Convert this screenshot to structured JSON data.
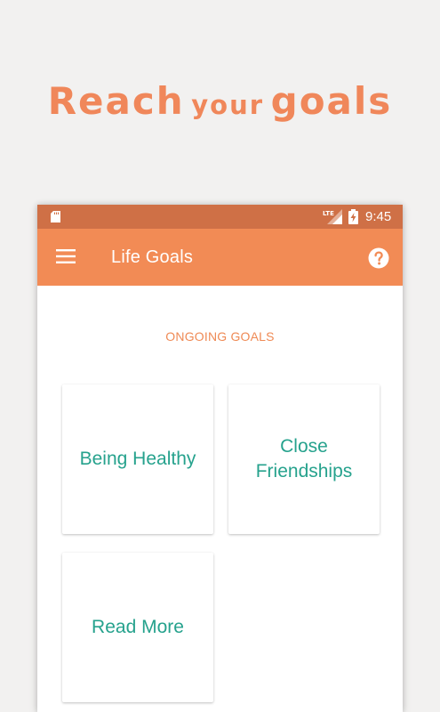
{
  "headline": {
    "word1": "Reach",
    "word2": "your",
    "word3": "goals"
  },
  "status_bar": {
    "network": "LTE",
    "time": "9:45"
  },
  "app_bar": {
    "title": "Life Goals",
    "menu_icon": "hamburger-menu-icon",
    "help_icon": "help-icon"
  },
  "section": {
    "title": "ONGOING GOALS"
  },
  "goals": [
    {
      "label": "Being Healthy"
    },
    {
      "label": "Close Friendships"
    },
    {
      "label": "Read More"
    }
  ],
  "colors": {
    "background": "#f2f1f0",
    "headline": "#f0875a",
    "status_bar": "#cf7046",
    "app_bar": "#f28b55",
    "section_title": "#ef8a55",
    "goal_text": "#26a28d",
    "card": "#ffffff"
  }
}
